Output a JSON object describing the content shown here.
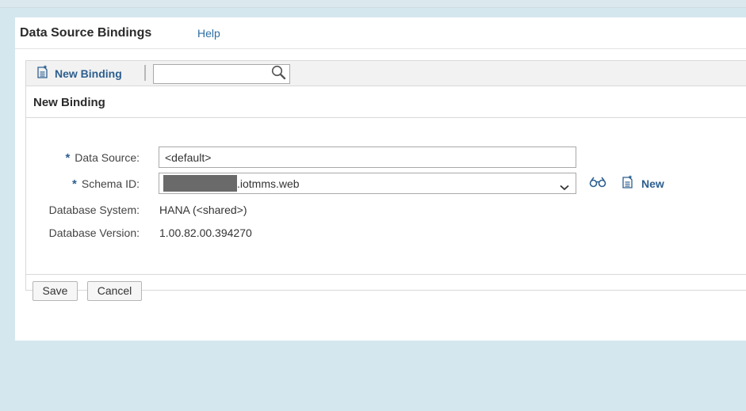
{
  "app": {
    "title": "Data Source Bindings",
    "help_label": "Help"
  },
  "toolbar": {
    "new_binding_label": "New Binding",
    "new_binding_icon": "document-new-icon",
    "search": {
      "value": "",
      "placeholder": "",
      "icon": "search-icon"
    }
  },
  "section": {
    "title": "New Binding"
  },
  "form": {
    "data_source": {
      "label": "Data Source:",
      "required_mark": "*",
      "value": "<default>"
    },
    "schema_id": {
      "label": "Schema ID:",
      "required_mark": "*",
      "value_suffix": ".iotmms.web",
      "value_redacted": true,
      "lookup_icon": "binoculars-icon",
      "new_label": "New",
      "new_icon": "document-new-icon"
    },
    "database_system": {
      "label": "Database System:",
      "value": "HANA (<shared>)"
    },
    "database_version": {
      "label": "Database Version:",
      "value": "1.00.82.00.394270"
    }
  },
  "footer": {
    "save_label": "Save",
    "cancel_label": "Cancel"
  },
  "colors": {
    "link": "#2e6ea3",
    "accent": "#2d5f8f",
    "page_background": "#d5e7ee",
    "redaction": "#6a6a6a"
  }
}
